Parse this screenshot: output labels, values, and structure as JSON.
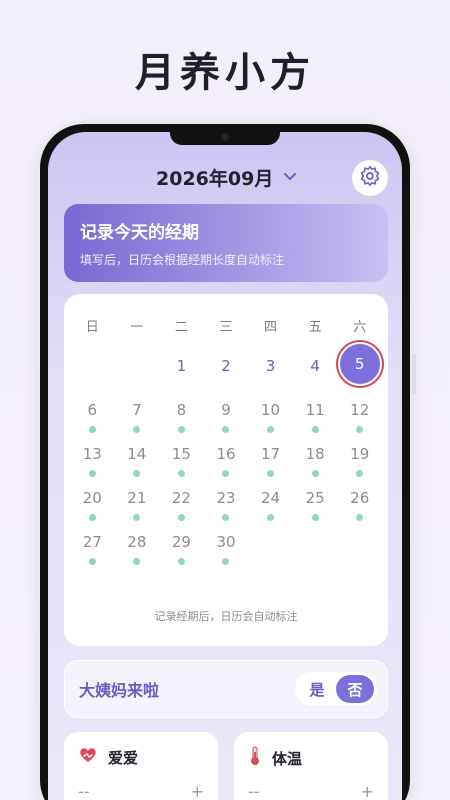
{
  "promo": {
    "title": "月养小方"
  },
  "header": {
    "month": "2026年09月",
    "chevron": "chevron-down-icon",
    "settings_icon": "gear-icon"
  },
  "banner": {
    "title": "记录今天的经期",
    "subtitle": "填写后，日历会根据经期长度自动标注"
  },
  "calendar": {
    "weekdays": [
      "日",
      "一",
      "二",
      "三",
      "四",
      "五",
      "六"
    ],
    "today": "5",
    "rows": [
      [
        null,
        null,
        "1",
        "2",
        "3",
        "4",
        "5"
      ],
      [
        "6",
        "7",
        "8",
        "9",
        "10",
        "11",
        "12"
      ],
      [
        "13",
        "14",
        "15",
        "16",
        "17",
        "18",
        "19"
      ],
      [
        "20",
        "21",
        "22",
        "23",
        "24",
        "25",
        "26"
      ],
      [
        "27",
        "28",
        "29",
        "30",
        null,
        null,
        null
      ]
    ],
    "note": "记录经期后，日历会自动标注",
    "dot_color": "#92d4cc",
    "accent": "#7d6fdb"
  },
  "period": {
    "label": "大姨妈来啦",
    "yes": "是",
    "no": "否",
    "selected": "否"
  },
  "cards": {
    "love": {
      "label": "爱爱",
      "icon": "heart-icon",
      "minus": "--",
      "plus": "+"
    },
    "temp": {
      "label": "体温",
      "icon": "thermometer-icon",
      "minus": "--",
      "plus": "+"
    }
  }
}
